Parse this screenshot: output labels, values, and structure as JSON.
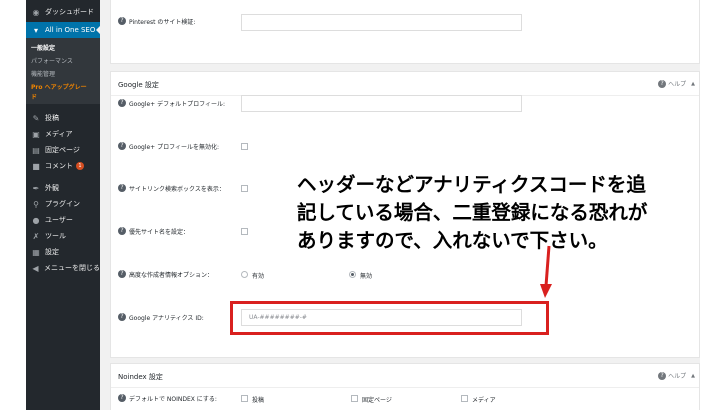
{
  "sidebar": {
    "items": [
      {
        "icon": "dashboard-icon",
        "glyph": "◉",
        "label": "ダッシュボード"
      },
      {
        "icon": "seo-icon",
        "glyph": "▾",
        "label": "All in One SEO"
      },
      {
        "icon": "pin-icon",
        "glyph": "✎",
        "label": "投稿"
      },
      {
        "icon": "media-icon",
        "glyph": "▣",
        "label": "メディア"
      },
      {
        "icon": "page-icon",
        "glyph": "▤",
        "label": "固定ページ"
      },
      {
        "icon": "comment-icon",
        "glyph": "■",
        "label": "コメント"
      },
      {
        "icon": "appearance-icon",
        "glyph": "✒",
        "label": "外観"
      },
      {
        "icon": "plugin-icon",
        "glyph": "⚲",
        "label": "プラグイン"
      },
      {
        "icon": "user-icon",
        "glyph": "●",
        "label": "ユーザー"
      },
      {
        "icon": "tool-icon",
        "glyph": "✗",
        "label": "ツール"
      },
      {
        "icon": "settings-icon",
        "glyph": "▦",
        "label": "設定"
      },
      {
        "icon": "collapse-icon",
        "glyph": "◀",
        "label": "メニューを閉じる"
      }
    ],
    "comment_badge": "1",
    "submenu": [
      "一般設定",
      "パフォーマンス",
      "機能管理",
      "Pro へアップグレー",
      "ド"
    ]
  },
  "pinterest": {
    "label": "Pinterest のサイト検証:"
  },
  "google_box": {
    "title": "Google 設定",
    "help": "ヘルプ",
    "rows": {
      "profile": "Google+ デフォルトプロフィール:",
      "disable_profile": "Google+ プロフィールを無効化:",
      "sitelinks": "サイトリンク検索ボックスを表示：",
      "preferred_name": "優先サイト名を設定：",
      "advanced_auth": "高度な作成者情報オプション：",
      "analytics": "Google アナリティクス ID:"
    },
    "advanced_options": [
      "有効",
      "無効"
    ],
    "advanced_selected": "無効",
    "analytics_placeholder": "UA-########-#"
  },
  "noindex_box": {
    "title": "Noindex 設定",
    "help": "ヘルプ",
    "row_label": "デフォルトで NOINDEX にする:",
    "options": [
      "投稿",
      "固定ページ",
      "メディア"
    ]
  },
  "callout": {
    "lines": [
      "ヘッダーなどアナリティクスコードを追",
      "記している場合、二重登録になる恐れが",
      "ありますので、入れないで下さい。"
    ],
    "color": "#d9201f"
  }
}
